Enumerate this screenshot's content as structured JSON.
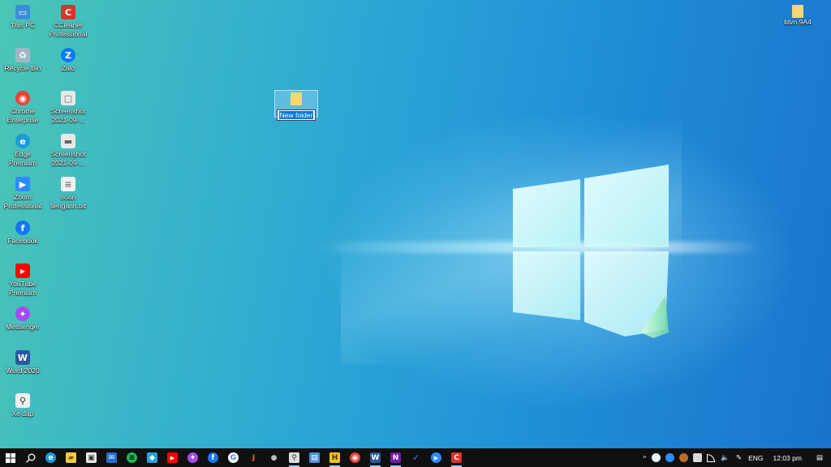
{
  "desktop": {
    "icons": [
      {
        "label": "This PC",
        "color": "#3a8fd8",
        "glyph": "▭"
      },
      {
        "label": "CCleaner Professional",
        "color": "#d8342c",
        "glyph": "C"
      },
      {
        "label": "Recycle Bin",
        "color": "#9fb8c8",
        "glyph": "♻"
      },
      {
        "label": "Zalo",
        "color": "#0a7cff",
        "glyph": "Z"
      },
      {
        "label": "Chrome Enterprise",
        "color": "#ea4335",
        "glyph": "◉"
      },
      {
        "label": "Screenshot 2021-09-...",
        "color": "#e8e8e8",
        "glyph": "▢"
      },
      {
        "label": "Edge Premium",
        "color": "#1b9bd8",
        "glyph": "e"
      },
      {
        "label": "Screenshot 2021-09-...",
        "color": "#e8e8e8",
        "glyph": "▬"
      },
      {
        "label": "Zoom Professional",
        "color": "#2d8cff",
        "glyph": "▶"
      },
      {
        "label": "soan tienganh.txt",
        "color": "#f2f2f2",
        "glyph": "≡"
      },
      {
        "label": "Facebook",
        "color": "#1877f2",
        "glyph": "f"
      },
      {
        "label": "YouTube Premium",
        "color": "#ff0000",
        "glyph": "▶"
      },
      {
        "label": "Messenger",
        "color": "#a34bf0",
        "glyph": "✦"
      },
      {
        "label": "Word 2020",
        "color": "#2b579a",
        "glyph": "W"
      },
      {
        "label": "Xe đạp",
        "color": "#eeeeee",
        "glyph": "⚲"
      },
      {
        "label": "btvn 9A4",
        "color": "#f7d774",
        "glyph": ""
      }
    ],
    "new_folder": {
      "label": "New folder",
      "state": "renaming"
    }
  },
  "taskbar": {
    "apps": [
      {
        "name": "start",
        "glyph": "⊞",
        "color": "#101010"
      },
      {
        "name": "search",
        "glyph": "⌕",
        "color": "#101010"
      },
      {
        "name": "edge",
        "glyph": "e",
        "color": "#1b9bd8"
      },
      {
        "name": "file-explorer",
        "glyph": "▰",
        "color": "#f2c94c"
      },
      {
        "name": "store",
        "glyph": "▣",
        "color": "#e8e8e8"
      },
      {
        "name": "mail",
        "glyph": "✉",
        "color": "#1f6fd0"
      },
      {
        "name": "spotify",
        "glyph": "≋",
        "color": "#1db954"
      },
      {
        "name": "app-cyan",
        "glyph": "◆",
        "color": "#22a6e0"
      },
      {
        "name": "youtube",
        "glyph": "▶",
        "color": "#ff0000"
      },
      {
        "name": "messenger",
        "glyph": "✦",
        "color": "#a34bf0"
      },
      {
        "name": "facebook",
        "glyph": "f",
        "color": "#1877f2"
      },
      {
        "name": "google",
        "glyph": "G",
        "color": "#ffffff"
      },
      {
        "name": "j-app",
        "glyph": "J",
        "color": "#f06a2a"
      },
      {
        "name": "apple",
        "glyph": "●",
        "color": "#bbbbbb"
      },
      {
        "name": "xe-dap",
        "glyph": "⚲",
        "color": "#dddddd"
      },
      {
        "name": "doc-scan",
        "glyph": "▤",
        "color": "#4a90e2"
      },
      {
        "name": "h-app",
        "glyph": "H",
        "color": "#f5c400"
      },
      {
        "name": "chrome",
        "glyph": "◉",
        "color": "#ea4335"
      },
      {
        "name": "word",
        "glyph": "W",
        "color": "#2b579a"
      },
      {
        "name": "onenote",
        "glyph": "N",
        "color": "#7719aa"
      },
      {
        "name": "todo",
        "glyph": "✓",
        "color": "#2f80ed"
      },
      {
        "name": "zoom",
        "glyph": "▶",
        "color": "#2d8cff"
      },
      {
        "name": "ccleaner",
        "glyph": "C",
        "color": "#d8342c"
      }
    ],
    "tray": {
      "chevron": "^",
      "language": "ENG",
      "time": "12:03 pm",
      "notification_glyph": "▤"
    }
  }
}
